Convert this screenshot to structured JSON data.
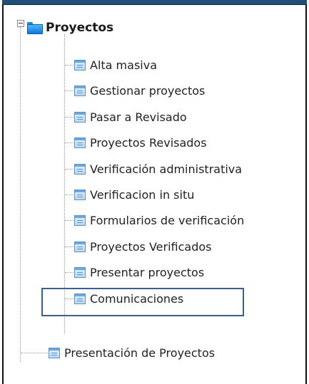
{
  "tree": {
    "root": {
      "label": "Proyectos",
      "icon": "folder-icon",
      "expanded": true,
      "children": [
        {
          "label": "Alta masiva",
          "icon": "document-icon"
        },
        {
          "label": "Gestionar proyectos",
          "icon": "document-icon"
        },
        {
          "label": "Pasar a Revisado",
          "icon": "document-icon"
        },
        {
          "label": "Proyectos Revisados",
          "icon": "document-icon"
        },
        {
          "label": "Verificación administrativa",
          "icon": "document-icon"
        },
        {
          "label": "Verificacion in situ",
          "icon": "document-icon"
        },
        {
          "label": "Formularios de verificación",
          "icon": "document-icon"
        },
        {
          "label": "Proyectos Verificados",
          "icon": "document-icon"
        },
        {
          "label": "Presentar proyectos",
          "icon": "document-icon",
          "highlighted": true
        },
        {
          "label": "Comunicaciones",
          "icon": "document-icon"
        }
      ]
    },
    "sibling": {
      "label": "Presentación de Proyectos",
      "icon": "document-icon"
    }
  },
  "colors": {
    "highlight_border": "#3a5f8c",
    "folder_blue": "#1f86d9",
    "frame": "#111111"
  }
}
